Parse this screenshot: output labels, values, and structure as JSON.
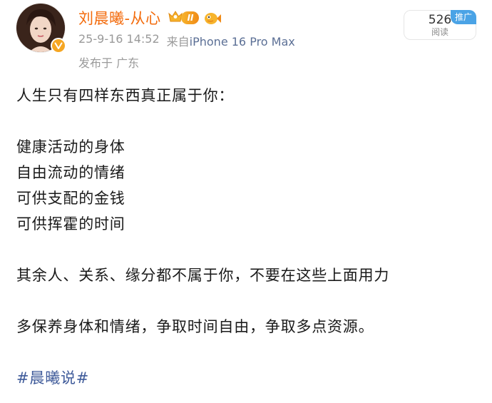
{
  "author": {
    "name": "刘晨曦-从心",
    "vip_level": "II"
  },
  "post_meta": {
    "time": "25-9-16 14:52",
    "source_prefix": "来自",
    "device": "iPhone 16 Pro Max",
    "location": "发布于 广东"
  },
  "stats": {
    "read_count": "526",
    "read_label": "阅读",
    "promo_tag": "推广"
  },
  "content": {
    "intro": "人生只有四样东西真正属于你：",
    "items": [
      "健康活动的身体",
      "自由流动的情绪",
      "可供支配的金钱",
      "可供挥霍的时间"
    ],
    "paragraph_1": "其余人、关系、缘分都不属于你，不要在这些上面用力",
    "paragraph_2": "多保养身体和情绪，争取时间自由，争取多点资源。",
    "hashtag": "#晨曦说#"
  },
  "colors": {
    "username": "#f36b0c",
    "meta_text": "#9a9a9a",
    "device_link": "#5b6f95",
    "hashtag": "#3f5b9a",
    "promo_bg": "#4aa3e6",
    "vip_gold": "#f08a16"
  },
  "icons": {
    "verified": "verified-v-icon",
    "vip_crown": "crown-icon",
    "fans": "fish-mascot-icon"
  }
}
